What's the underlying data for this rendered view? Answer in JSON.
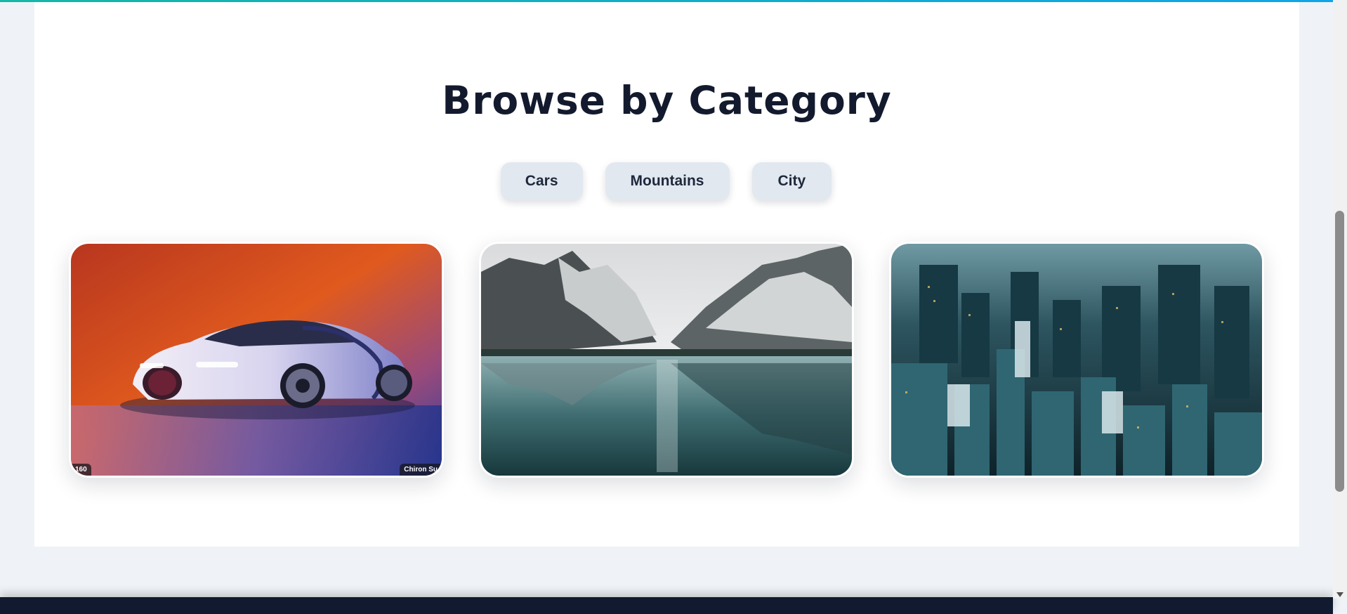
{
  "section": {
    "title": "Browse by Category"
  },
  "filters": [
    {
      "label": "Cars"
    },
    {
      "label": "Mountains"
    },
    {
      "label": "City"
    }
  ],
  "cards": [
    {
      "category": "Cars",
      "badge_left": "160",
      "badge_right": "Chiron Su"
    },
    {
      "category": "Mountains"
    },
    {
      "category": "City"
    }
  ],
  "colors": {
    "accent_top": "#14b8a6",
    "page_bg": "#eff3f7",
    "panel_bg": "#ffffff",
    "pill_bg": "#e2e8f0",
    "heading": "#131a2e",
    "footer": "#111a2e"
  }
}
